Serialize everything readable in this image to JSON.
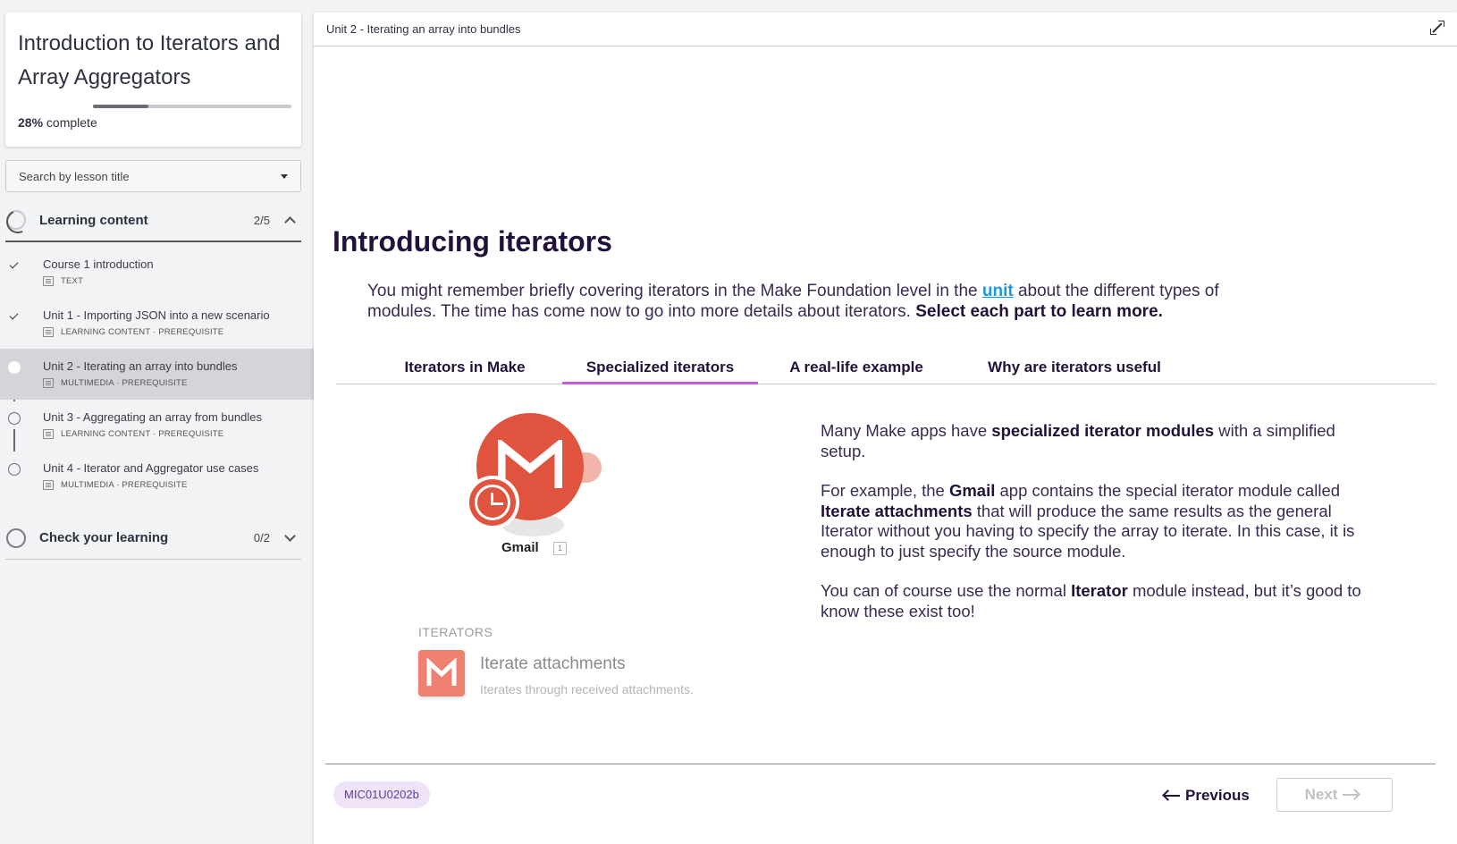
{
  "course": {
    "title": "Introduction to Iterators and Array Aggregators",
    "progress_value": "28%",
    "progress_suffix": "complete",
    "progress_fraction": 0.28
  },
  "search": {
    "placeholder": "Search by lesson title"
  },
  "sections": [
    {
      "label": "Learning content",
      "count": "2/5",
      "expanded": true,
      "lessons": [
        {
          "title": "Course 1 introduction",
          "meta": "TEXT",
          "status": "done"
        },
        {
          "title": "Unit 1 - Importing JSON into a new scenario",
          "meta": "LEARNING CONTENT · PREREQUISITE",
          "status": "done"
        },
        {
          "title": "Unit 2 - Iterating an array into bundles",
          "meta": "MULTIMEDIA · PREREQUISITE",
          "status": "current"
        },
        {
          "title": "Unit 3 - Aggregating an array from bundles",
          "meta": "LEARNING CONTENT · PREREQUISITE",
          "status": "open"
        },
        {
          "title": "Unit 4 - Iterator and Aggregator use cases",
          "meta": "MULTIMEDIA · PREREQUISITE",
          "status": "open"
        }
      ]
    },
    {
      "label": "Check your learning",
      "count": "0/2",
      "expanded": false
    }
  ],
  "main": {
    "breadcrumb": "Unit 2 - Iterating an array into bundles",
    "heading": "Introducing iterators",
    "intro": {
      "before": "You might remember briefly covering iterators in the Make Foundation level in the ",
      "link": "unit",
      "after": " about the different types of modules. The time has come now to go into more details about iterators. ",
      "strong": "Select each part to learn more."
    },
    "tabs": [
      {
        "label": "Iterators in Make",
        "active": false
      },
      {
        "label": "Specialized iterators",
        "active": true
      },
      {
        "label": "A real-life example",
        "active": false
      },
      {
        "label": "Why are iterators useful",
        "active": false
      }
    ],
    "illustration": {
      "app_label": "Gmail",
      "module_number": "1"
    },
    "description": {
      "p1_a": "Many Make apps have ",
      "p1_b": "specialized iterator modules",
      "p1_c": " with a simplified setup.",
      "p2_a": "For example, the ",
      "p2_b": "Gmail",
      "p2_c": " app contains the special iterator module called ",
      "p2_d": "Iterate attachments",
      "p2_e": " that will produce the same results as the general Iterator without you having to specify the array to iterate. In this case, it is enough to just specify the source module.",
      "p3_a": "You can of course use the normal ",
      "p3_b": "Iterator",
      "p3_c": " module instead, but it’s good to know these exist too!"
    },
    "iterator_card": {
      "caption": "ITERATORS",
      "name": "Iterate attachments",
      "subtitle": "Iterates through received attachments."
    },
    "footer": {
      "code": "MIC01U0202b",
      "previous": "Previous",
      "next": "Next"
    }
  },
  "colors": {
    "accent_tab": "#c95be0",
    "link": "#1a9ad6",
    "gmail_red": "#e0533e",
    "heading": "#22113a"
  }
}
